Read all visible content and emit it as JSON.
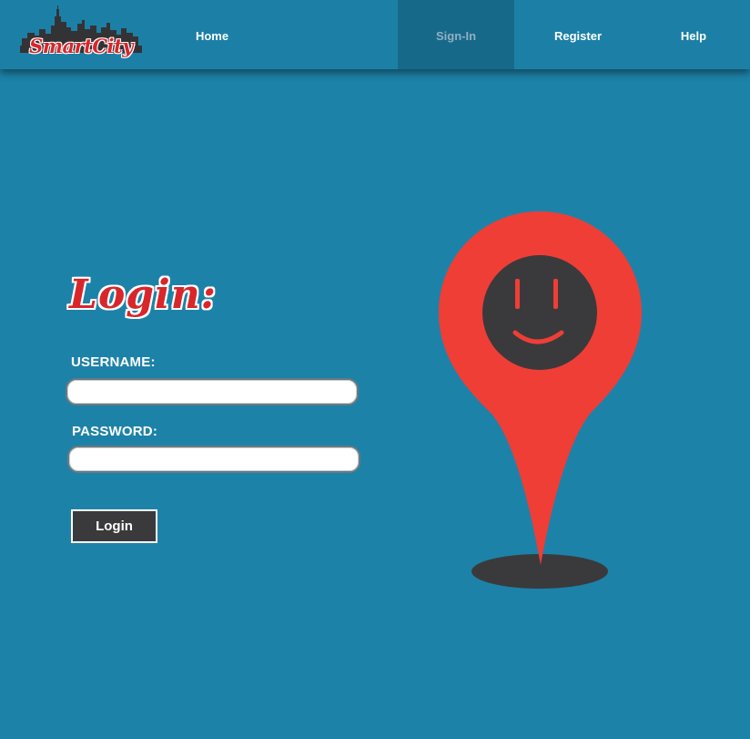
{
  "app": {
    "logo_text": "SmartCity"
  },
  "nav": {
    "items": [
      {
        "label": "Home"
      },
      {
        "label": "Sign-In",
        "active": true
      },
      {
        "label": "Register"
      },
      {
        "label": "Help"
      }
    ]
  },
  "login_form": {
    "title": "Login:",
    "username_label": "USERNAME:",
    "username_value": "",
    "password_label": "PASSWORD:",
    "password_value": "",
    "submit_label": "Login"
  },
  "illustration": {
    "icon": "smiley-location-pin-icon"
  },
  "colors": {
    "background": "#1d82a8",
    "nav_active": "#17698a",
    "brand_red": "#d8262a",
    "pin_red": "#ef3e36",
    "dark": "#3a3a3c"
  }
}
